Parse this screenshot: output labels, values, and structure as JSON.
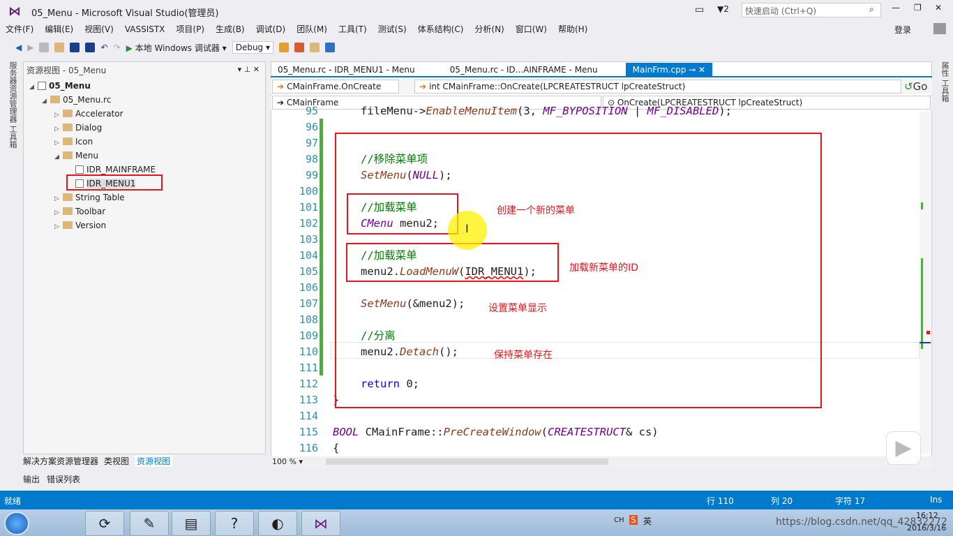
{
  "window": {
    "title": "05_Menu - Microsoft Visual Studio(管理员)",
    "notifications": "2",
    "quick_launch_placeholder": "快速启动 (Ctrl+Q)",
    "login": "登录"
  },
  "menu": [
    "文件(F)",
    "编辑(E)",
    "视图(V)",
    "VASSISTX",
    "项目(P)",
    "生成(B)",
    "调试(D)",
    "团队(M)",
    "工具(T)",
    "测试(S)",
    "体系结构(C)",
    "分析(N)",
    "窗口(W)",
    "帮助(H)"
  ],
  "toolbar": {
    "run_label": "本地 Windows 调试器",
    "config": "Debug"
  },
  "left_panel": {
    "title": "资源视图 - 05_Menu",
    "tree": [
      {
        "label": "05_Menu",
        "level": 0,
        "type": "project",
        "expanded": true
      },
      {
        "label": "05_Menu.rc",
        "level": 1,
        "type": "folder",
        "expanded": true
      },
      {
        "label": "Accelerator",
        "level": 2,
        "type": "folder",
        "expanded": false
      },
      {
        "label": "Dialog",
        "level": 2,
        "type": "folder",
        "expanded": false
      },
      {
        "label": "Icon",
        "level": 2,
        "type": "folder",
        "expanded": false
      },
      {
        "label": "Menu",
        "level": 2,
        "type": "folder",
        "expanded": true
      },
      {
        "label": "IDR_MAINFRAME",
        "level": 3,
        "type": "file"
      },
      {
        "label": "IDR_MENU1",
        "level": 3,
        "type": "file",
        "selected": true
      },
      {
        "label": "String Table",
        "level": 2,
        "type": "folder",
        "expanded": false
      },
      {
        "label": "Toolbar",
        "level": 2,
        "type": "folder",
        "expanded": false
      },
      {
        "label": "Version",
        "level": 2,
        "type": "folder",
        "expanded": false
      }
    ],
    "bottom_tabs": [
      "解决方案资源管理器",
      "类视图",
      "资源视图"
    ],
    "output_tabs": [
      "输出",
      "错误列表"
    ],
    "side_tabs": "服务器资源管理器 工具箱"
  },
  "right_side_tabs": "属性 工具箱",
  "editor": {
    "tabs": [
      "05_Menu.rc - IDR_MENU1 - Menu",
      "05_Menu.rc - ID...AINFRAME - Menu",
      "MainFrm.cpp"
    ],
    "nav": {
      "scope": "CMainFrame.OnCreate",
      "function": "int CMainFrame::OnCreate(LPCREATESTRUCT lpCreateStruct)",
      "go": "Go",
      "class": "CMainFrame",
      "member": "OnCreate(LPCREATESTRUCT lpCreateStruct)"
    },
    "zoom": "100 %",
    "lines": [
      {
        "n": "95",
        "indent": 1,
        "tokens": [
          [
            "pl",
            "fileMenu->"
          ],
          [
            "fn",
            "EnableMenuItem"
          ],
          [
            "pl",
            "(3, "
          ],
          [
            "mc",
            "MF_BYPOSITION"
          ],
          [
            "pl",
            " | "
          ],
          [
            "mc",
            "MF_DISABLED"
          ],
          [
            "pl",
            ");"
          ]
        ]
      },
      {
        "n": "96",
        "indent": 0,
        "tokens": []
      },
      {
        "n": "97",
        "indent": 0,
        "tokens": []
      },
      {
        "n": "98",
        "indent": 1,
        "tokens": [
          [
            "cm",
            "//移除菜单项"
          ]
        ]
      },
      {
        "n": "99",
        "indent": 1,
        "tokens": [
          [
            "fn",
            "SetMenu"
          ],
          [
            "pl",
            "("
          ],
          [
            "mc",
            "NULL"
          ],
          [
            "pl",
            ");"
          ]
        ]
      },
      {
        "n": "100",
        "indent": 0,
        "tokens": []
      },
      {
        "n": "101",
        "indent": 1,
        "tokens": [
          [
            "cm",
            "//加载菜单"
          ]
        ]
      },
      {
        "n": "102",
        "indent": 1,
        "tokens": [
          [
            "mc",
            "CMenu"
          ],
          [
            "pl",
            " menu2;"
          ]
        ]
      },
      {
        "n": "103",
        "indent": 0,
        "tokens": []
      },
      {
        "n": "104",
        "indent": 1,
        "tokens": [
          [
            "cm",
            "//加载菜单"
          ]
        ]
      },
      {
        "n": "105",
        "indent": 1,
        "tokens": [
          [
            "pl",
            "menu2."
          ],
          [
            "fn",
            "LoadMenuW"
          ],
          [
            "pl",
            "("
          ],
          [
            "sq",
            "IDR_MENU1"
          ],
          [
            "pl",
            ");"
          ]
        ]
      },
      {
        "n": "106",
        "indent": 0,
        "tokens": []
      },
      {
        "n": "107",
        "indent": 1,
        "tokens": [
          [
            "fn",
            "SetMenu"
          ],
          [
            "pl",
            "(&menu2);"
          ]
        ]
      },
      {
        "n": "108",
        "indent": 0,
        "tokens": []
      },
      {
        "n": "109",
        "indent": 1,
        "tokens": [
          [
            "cm",
            "//分离"
          ]
        ]
      },
      {
        "n": "110",
        "indent": 1,
        "tokens": [
          [
            "pl",
            "menu2."
          ],
          [
            "fn",
            "Detach"
          ],
          [
            "pl",
            "();"
          ]
        ]
      },
      {
        "n": "111",
        "indent": 0,
        "tokens": []
      },
      {
        "n": "112",
        "indent": 1,
        "tokens": [
          [
            "kw",
            "return"
          ],
          [
            "pl",
            " 0;"
          ]
        ]
      },
      {
        "n": "113",
        "indent": 0,
        "tokens": [
          [
            "pl",
            "}"
          ]
        ]
      },
      {
        "n": "114",
        "indent": 0,
        "tokens": []
      },
      {
        "n": "115",
        "indent": 0,
        "tokens": [
          [
            "mc",
            "BOOL"
          ],
          [
            "pl",
            " CMainFrame::"
          ],
          [
            "fn",
            "PreCreateWindow"
          ],
          [
            "pl",
            "("
          ],
          [
            "mc",
            "CREATESTRUCT"
          ],
          [
            "pl",
            "& cs)"
          ]
        ]
      },
      {
        "n": "116",
        "indent": 0,
        "tokens": [
          [
            "pl",
            "{"
          ]
        ]
      }
    ],
    "annotations": [
      "创建一个新的菜单",
      "加载新菜单的ID",
      "设置菜单显示",
      "保持菜单存在"
    ]
  },
  "status": {
    "ready": "就绪",
    "line": "行 110",
    "col": "列 20",
    "char": "字符 17",
    "mode": "Ins"
  },
  "tray": {
    "lang": "CH",
    "ime": "英",
    "time": "16:12",
    "date": "2016/3/16"
  },
  "watermark": "https://blog.csdn.net/qq_42832272",
  "colors": {
    "accent": "#007acc",
    "annotation": "#e8141c",
    "comment": "#008000"
  }
}
